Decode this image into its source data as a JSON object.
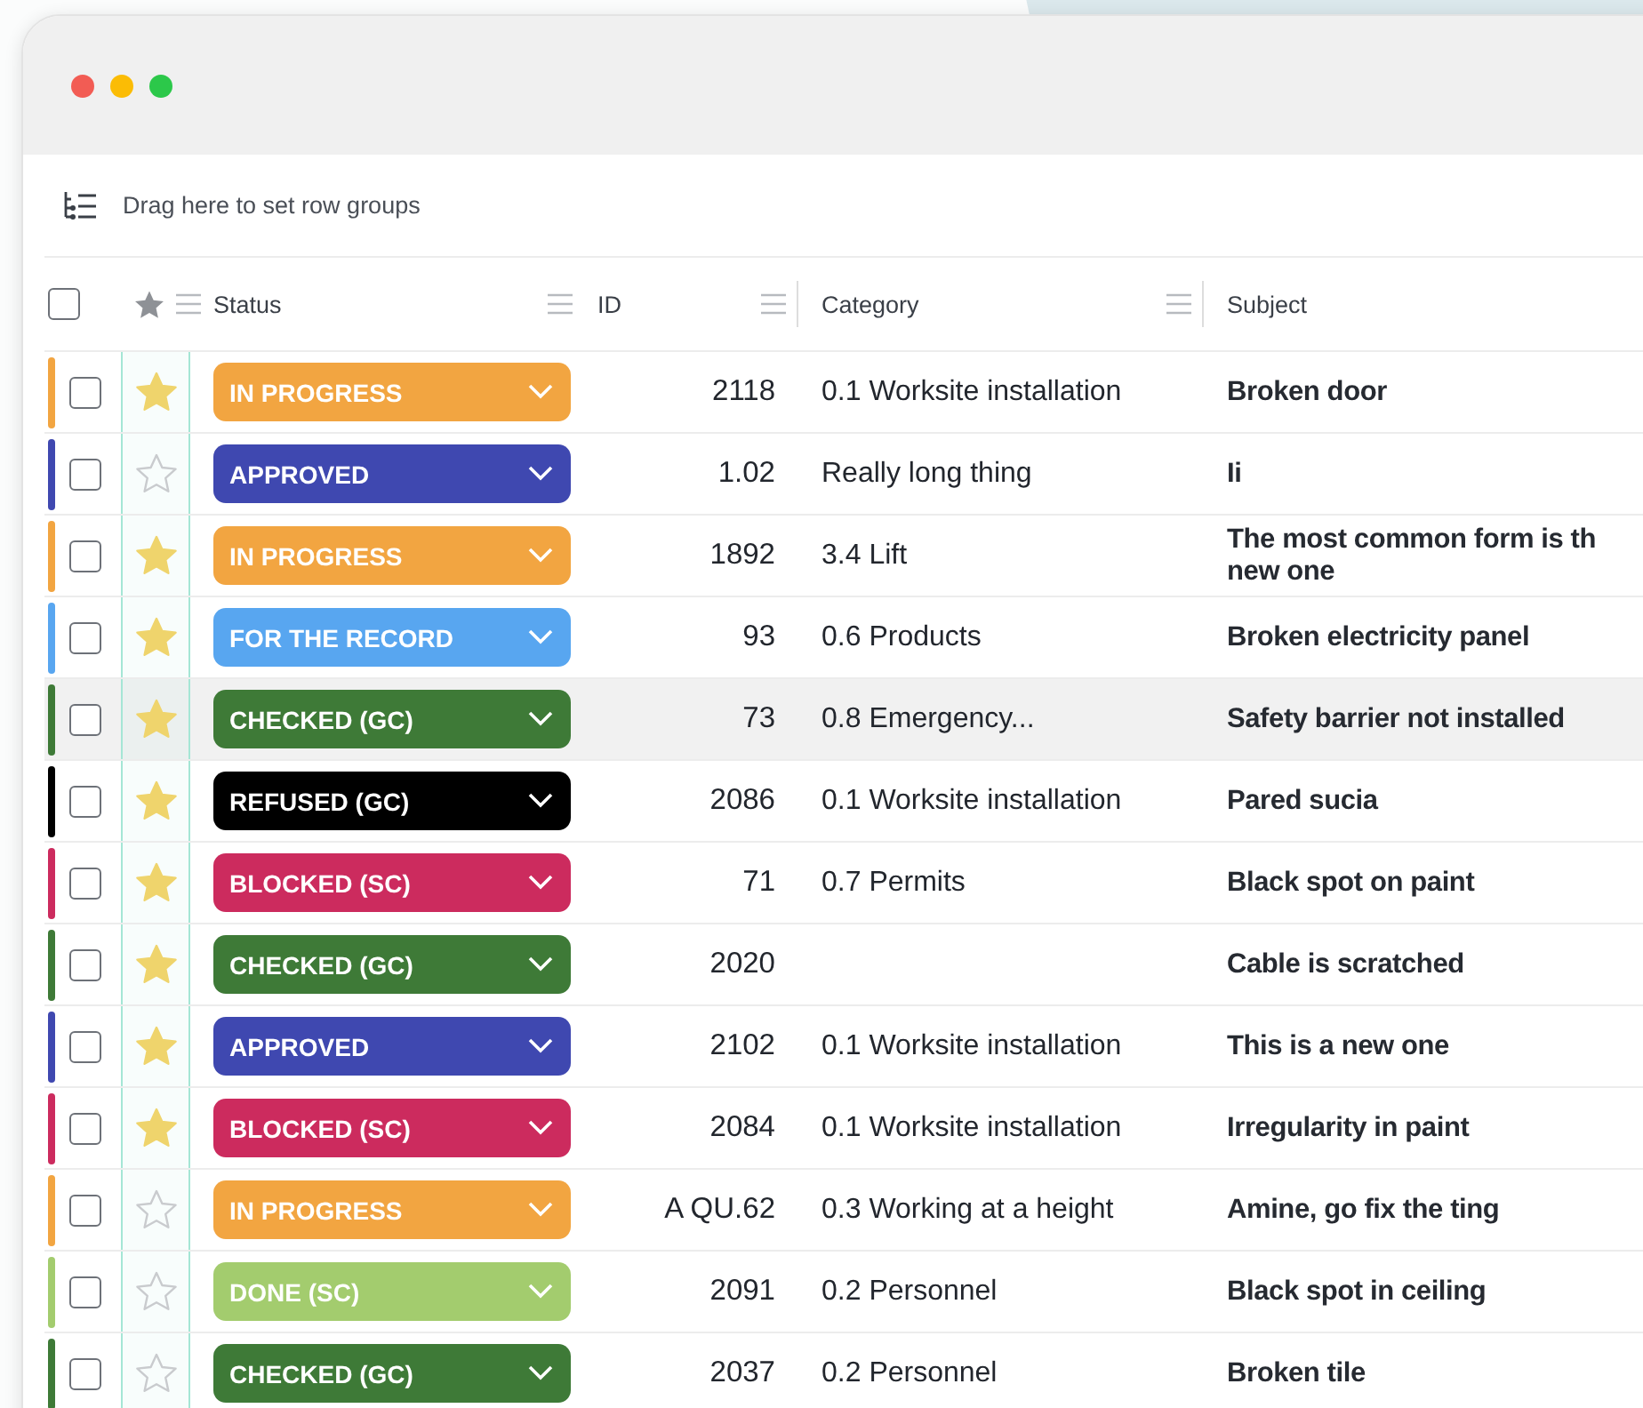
{
  "toolbar": {
    "label": "Drag here to set row groups"
  },
  "header": {
    "select_all_checked": false,
    "columns": [
      "Status",
      "ID",
      "Category",
      "Subject"
    ]
  },
  "rows": [
    {
      "color": "#f2a541",
      "checked": false,
      "starred": true,
      "highlighted": false,
      "status": "IN PROGRESS",
      "id": "2118",
      "category": "0.1 Worksite installation",
      "subject": "Broken door"
    },
    {
      "color": "#3f48b0",
      "checked": false,
      "starred": false,
      "highlighted": false,
      "status": "APPROVED",
      "id": "1.02",
      "category": "Really long thing",
      "subject": "Ii"
    },
    {
      "color": "#f2a541",
      "checked": false,
      "starred": true,
      "highlighted": false,
      "status": "IN PROGRESS",
      "id": "1892",
      "category": "3.4 Lift",
      "subject": "The most common form is th\nnew one"
    },
    {
      "color": "#58a6f0",
      "checked": false,
      "starred": true,
      "highlighted": false,
      "status": "FOR THE RECORD",
      "id": "93",
      "category": "0.6 Products",
      "subject": "Broken electricity panel"
    },
    {
      "color": "#3e7a37",
      "checked": false,
      "starred": true,
      "highlighted": true,
      "status": "CHECKED (GC)",
      "id": "73",
      "category": "0.8 Emergency...",
      "subject": "Safety barrier not installed"
    },
    {
      "color": "#000000",
      "checked": false,
      "starred": true,
      "highlighted": false,
      "status": "REFUSED (GC)",
      "id": "2086",
      "category": "0.1 Worksite installation",
      "subject": "Pared sucia"
    },
    {
      "color": "#cc2b5e",
      "checked": false,
      "starred": true,
      "highlighted": false,
      "status": "BLOCKED (SC)",
      "id": "71",
      "category": "0.7 Permits",
      "subject": "Black spot on paint"
    },
    {
      "color": "#3e7a37",
      "checked": false,
      "starred": true,
      "highlighted": false,
      "status": "CHECKED (GC)",
      "id": "2020",
      "subject": "Cable is scratched"
    },
    {
      "color": "#3f48b0",
      "checked": false,
      "starred": true,
      "highlighted": false,
      "status": "APPROVED",
      "id": "2102",
      "category": "0.1 Worksite installation",
      "subject": "This is a new one"
    },
    {
      "color": "#cc2b5e",
      "checked": false,
      "starred": true,
      "highlighted": false,
      "status": "BLOCKED (SC)",
      "id": "2084",
      "category": "0.1 Worksite installation",
      "subject": "Irregularity in paint"
    },
    {
      "color": "#f2a541",
      "checked": false,
      "starred": false,
      "highlighted": false,
      "status": "IN PROGRESS",
      "id": "A QU.62",
      "category": "0.3 Working at a height",
      "subject": "Amine, go fix the ting"
    },
    {
      "color": "#a3cc6e",
      "checked": false,
      "starred": false,
      "highlighted": false,
      "status": "DONE (SC)",
      "id": "2091",
      "category": "0.2 Personnel",
      "subject": "Black spot in ceiling"
    },
    {
      "color": "#3e7a37",
      "checked": false,
      "starred": false,
      "highlighted": false,
      "status": "CHECKED (GC)",
      "id": "2037",
      "category": "0.2 Personnel",
      "subject": "Broken tile"
    }
  ]
}
